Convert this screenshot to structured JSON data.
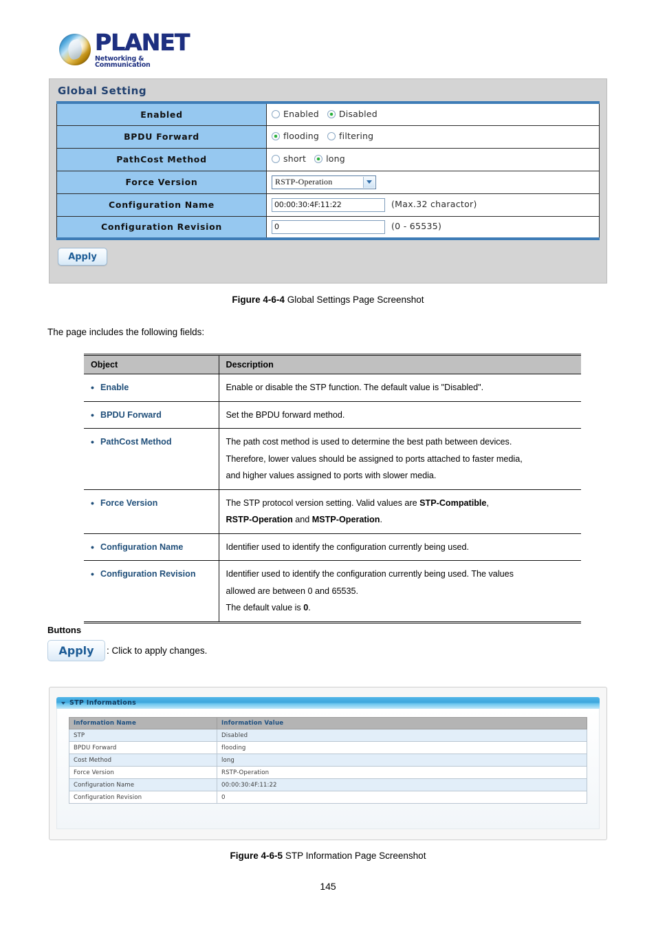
{
  "logo": {
    "name": "PLANET",
    "tagline": "Networking & Communication"
  },
  "screenshot1": {
    "panel_title": "Global Setting",
    "rows": [
      {
        "label": "Enabled",
        "type": "radio",
        "options": [
          {
            "label": "Enabled",
            "selected": false
          },
          {
            "label": "Disabled",
            "selected": true
          }
        ]
      },
      {
        "label": "BPDU Forward",
        "type": "radio",
        "options": [
          {
            "label": "flooding",
            "selected": true
          },
          {
            "label": "filtering",
            "selected": false
          }
        ]
      },
      {
        "label": "PathCost Method",
        "type": "radio",
        "options": [
          {
            "label": "short",
            "selected": false
          },
          {
            "label": "long",
            "selected": true
          }
        ]
      },
      {
        "label": "Force Version",
        "type": "select",
        "value": "RSTP-Operation"
      },
      {
        "label": "Configuration Name",
        "type": "text",
        "value": "00:00:30:4F:11:22",
        "hint": "(Max.32 charactor)"
      },
      {
        "label": "Configuration Revision",
        "type": "text",
        "value": "0",
        "hint": "(0 - 65535)"
      }
    ],
    "apply_label": "Apply"
  },
  "caption1": {
    "figure": "Figure 4-6-4",
    "text": " Global Settings Page Screenshot"
  },
  "intro_text": "The page includes the following fields:",
  "desc_table": {
    "headers": {
      "object": "Object",
      "description": "Description"
    },
    "rows": [
      {
        "object": "Enable",
        "lines": [
          [
            {
              "t": "Enable or disable the STP function. The default value is \"Disabled\".",
              "b": false
            }
          ]
        ]
      },
      {
        "object": "BPDU Forward",
        "lines": [
          [
            {
              "t": "Set the BPDU forward method.",
              "b": false
            }
          ]
        ]
      },
      {
        "object": "PathCost Method",
        "lines": [
          [
            {
              "t": "The path cost method is used to determine the best path between devices.",
              "b": false
            }
          ],
          [
            {
              "t": "Therefore, lower values should be assigned to ports attached to faster media,",
              "b": false
            }
          ],
          [
            {
              "t": "and higher values assigned to ports with slower media.",
              "b": false
            }
          ]
        ]
      },
      {
        "object": "Force Version",
        "lines": [
          [
            {
              "t": "The STP protocol version setting. Valid values are ",
              "b": false
            },
            {
              "t": "STP-Compatible",
              "b": true
            },
            {
              "t": ",",
              "b": false
            }
          ],
          [
            {
              "t": "RSTP-Operation",
              "b": true
            },
            {
              "t": " and ",
              "b": false
            },
            {
              "t": "MSTP-Operation",
              "b": true
            },
            {
              "t": ".",
              "b": false
            }
          ]
        ]
      },
      {
        "object": "Configuration Name",
        "lines": [
          [
            {
              "t": "Identifier used to identify the configuration currently being used.",
              "b": false
            }
          ]
        ]
      },
      {
        "object": "Configuration Revision",
        "lines": [
          [
            {
              "t": "Identifier used to identify the configuration currently being used. The values",
              "b": false
            }
          ],
          [
            {
              "t": "allowed are between 0 and 65535.",
              "b": false
            }
          ],
          [
            {
              "t": "The default value is ",
              "b": false
            },
            {
              "t": "0",
              "b": true
            },
            {
              "t": ".",
              "b": false
            }
          ]
        ]
      }
    ]
  },
  "buttons_section": {
    "heading": "Buttons",
    "apply_label": "Apply",
    "note": ": Click to apply changes."
  },
  "screenshot2": {
    "panel_title": "STP Informations",
    "headers": {
      "name": "Information Name",
      "value": "Information Value"
    },
    "rows": [
      {
        "name": "STP",
        "value": "Disabled"
      },
      {
        "name": "BPDU Forward",
        "value": "flooding"
      },
      {
        "name": "Cost Method",
        "value": "long"
      },
      {
        "name": "Force Version",
        "value": "RSTP-Operation"
      },
      {
        "name": "Configuration Name",
        "value": "00:00:30:4F:11:22"
      },
      {
        "name": "Configuration Revision",
        "value": "0"
      }
    ]
  },
  "caption2": {
    "figure": "Figure 4-6-5",
    "text": " STP Information Page Screenshot"
  },
  "page_number": "145"
}
